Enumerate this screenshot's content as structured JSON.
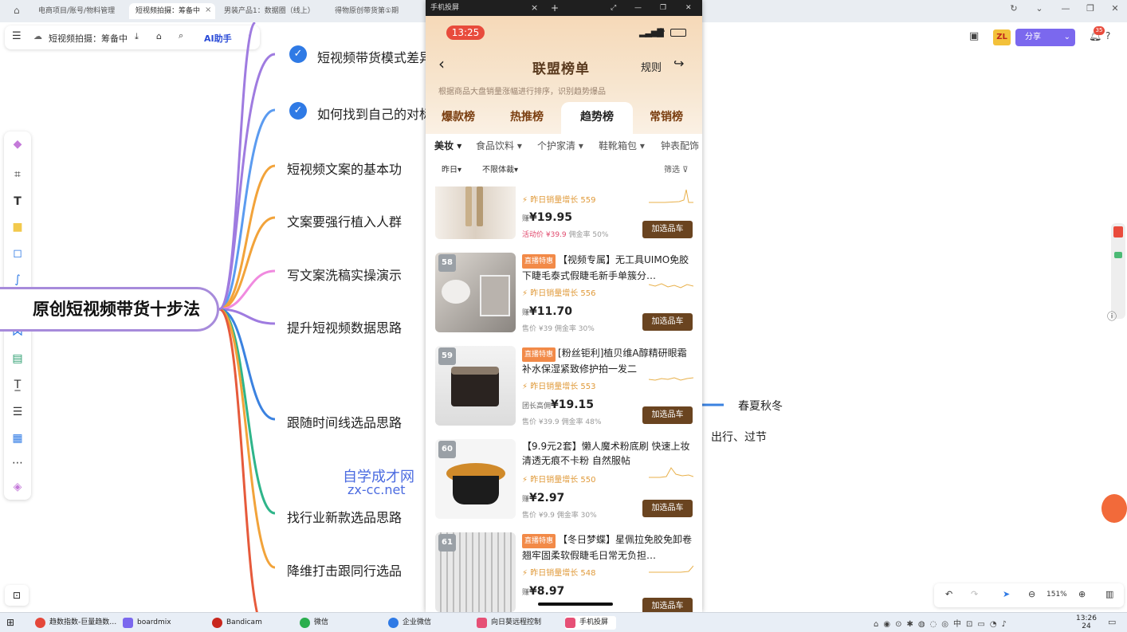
{
  "browser": {
    "tabs": [
      {
        "label": "电商项目/账号/物料管理"
      },
      {
        "label": "短视频拍摄：筹备中"
      },
      {
        "label": "男装产品1：数据圈（线上）"
      },
      {
        "label": "得物原创带货第①期"
      }
    ]
  },
  "toolbar": {
    "doc_title": "短视频拍摄：筹备中",
    "ai_label": "AI助手",
    "share_label": "分享",
    "avatar": "ZL",
    "notify_count": "35"
  },
  "mindmap": {
    "root": "原创短视频带货十步法",
    "nodes": [
      {
        "label": "短视频带货模式差异",
        "checked": true
      },
      {
        "label": "如何找到自己的对标",
        "checked": true
      },
      {
        "label": "短视频文案的基本功"
      },
      {
        "label": "文案要强行植入人群"
      },
      {
        "label": "写文案洗稿实操演示"
      },
      {
        "label": "提升短视频数据思路"
      },
      {
        "label": "跟随时间线选品思路"
      },
      {
        "label": "找行业新款选品思路"
      },
      {
        "label": "降维打击跟同行选品"
      }
    ],
    "right_nodes": [
      "春夏秋冬",
      "出行、过节"
    ],
    "watermark": {
      "line1": "自学成才网",
      "line2": "zx-cc.net"
    }
  },
  "phone": {
    "window_title": "手机投屏",
    "status_time": "13:25",
    "header": {
      "title": "联盟榜单",
      "rules": "规则",
      "hint": "根据商品大盘销量涨幅进行排序，识别趋势爆品"
    },
    "rank_tabs": [
      "爆款榜",
      "热推榜",
      "趋势榜",
      "常销榜"
    ],
    "categories": [
      "美妆",
      "食品饮料",
      "个护家清",
      "鞋靴箱包",
      "钟表配饰"
    ],
    "filters": {
      "date": "昨日",
      "type": "不限体裁",
      "screen": "筛选"
    },
    "products": [
      {
        "rank": "",
        "tag": "",
        "title": "",
        "growth": "昨日销量增长 559",
        "price_label": "赚",
        "price": "¥19.95",
        "sub_left": "活动价 ¥39.9",
        "sub_right": "佣金率 50%",
        "add": "加选品车"
      },
      {
        "rank": "58",
        "tag": "直播特惠",
        "title": "【视频专属】无工具UIMO免胶下睫毛泰式假睫毛新手单簇分…",
        "growth": "昨日销量增长 556",
        "price_label": "赚",
        "price": "¥11.70",
        "sub_left": "售价 ¥39",
        "sub_right": "佣金率 30%",
        "add": "加选品车"
      },
      {
        "rank": "59",
        "tag": "直播特惠",
        "title": "[粉丝钜利]植贝维A醇精研眼霜补水保湿紧致修护拍一发二",
        "growth": "昨日销量增长 553",
        "price_label": "团长高佣",
        "price": "¥19.15",
        "sub_left": "售价 ¥39.9",
        "sub_right": "佣金率 48%",
        "add": "加选品车"
      },
      {
        "rank": "60",
        "tag": "",
        "title": "【9.9元2套】懒人魔术粉底刷 快速上妆 清透无痕不卡粉 自然服帖",
        "growth": "昨日销量增长 550",
        "price_label": "赚",
        "price": "¥2.97",
        "sub_left": "售价 ¥9.9",
        "sub_right": "佣金率 30%",
        "add": "加选品车"
      },
      {
        "rank": "61",
        "tag": "直播特惠",
        "title": "【冬日梦蝶】星佩拉免胶免卸卷翘牢固柔软假睫毛日常无负担…",
        "growth": "昨日销量增长 548",
        "price_label": "赚",
        "price": "¥8.97",
        "sub_left": "",
        "sub_right": "",
        "add": "加选品车"
      }
    ]
  },
  "zoom": {
    "level": "151%"
  },
  "taskbar": {
    "items": [
      "趋数指数-巨量趋数…",
      "boardmix",
      "Bandicam",
      "微信",
      "企业微信",
      "向日葵远程控制",
      "手机投屏"
    ],
    "time": "13:26",
    "date": "24"
  },
  "colors": {
    "accent": "#7b68ee",
    "check": "#2f7ae5",
    "root_border": "#a78bdb",
    "add_btn": "#6a4420"
  }
}
